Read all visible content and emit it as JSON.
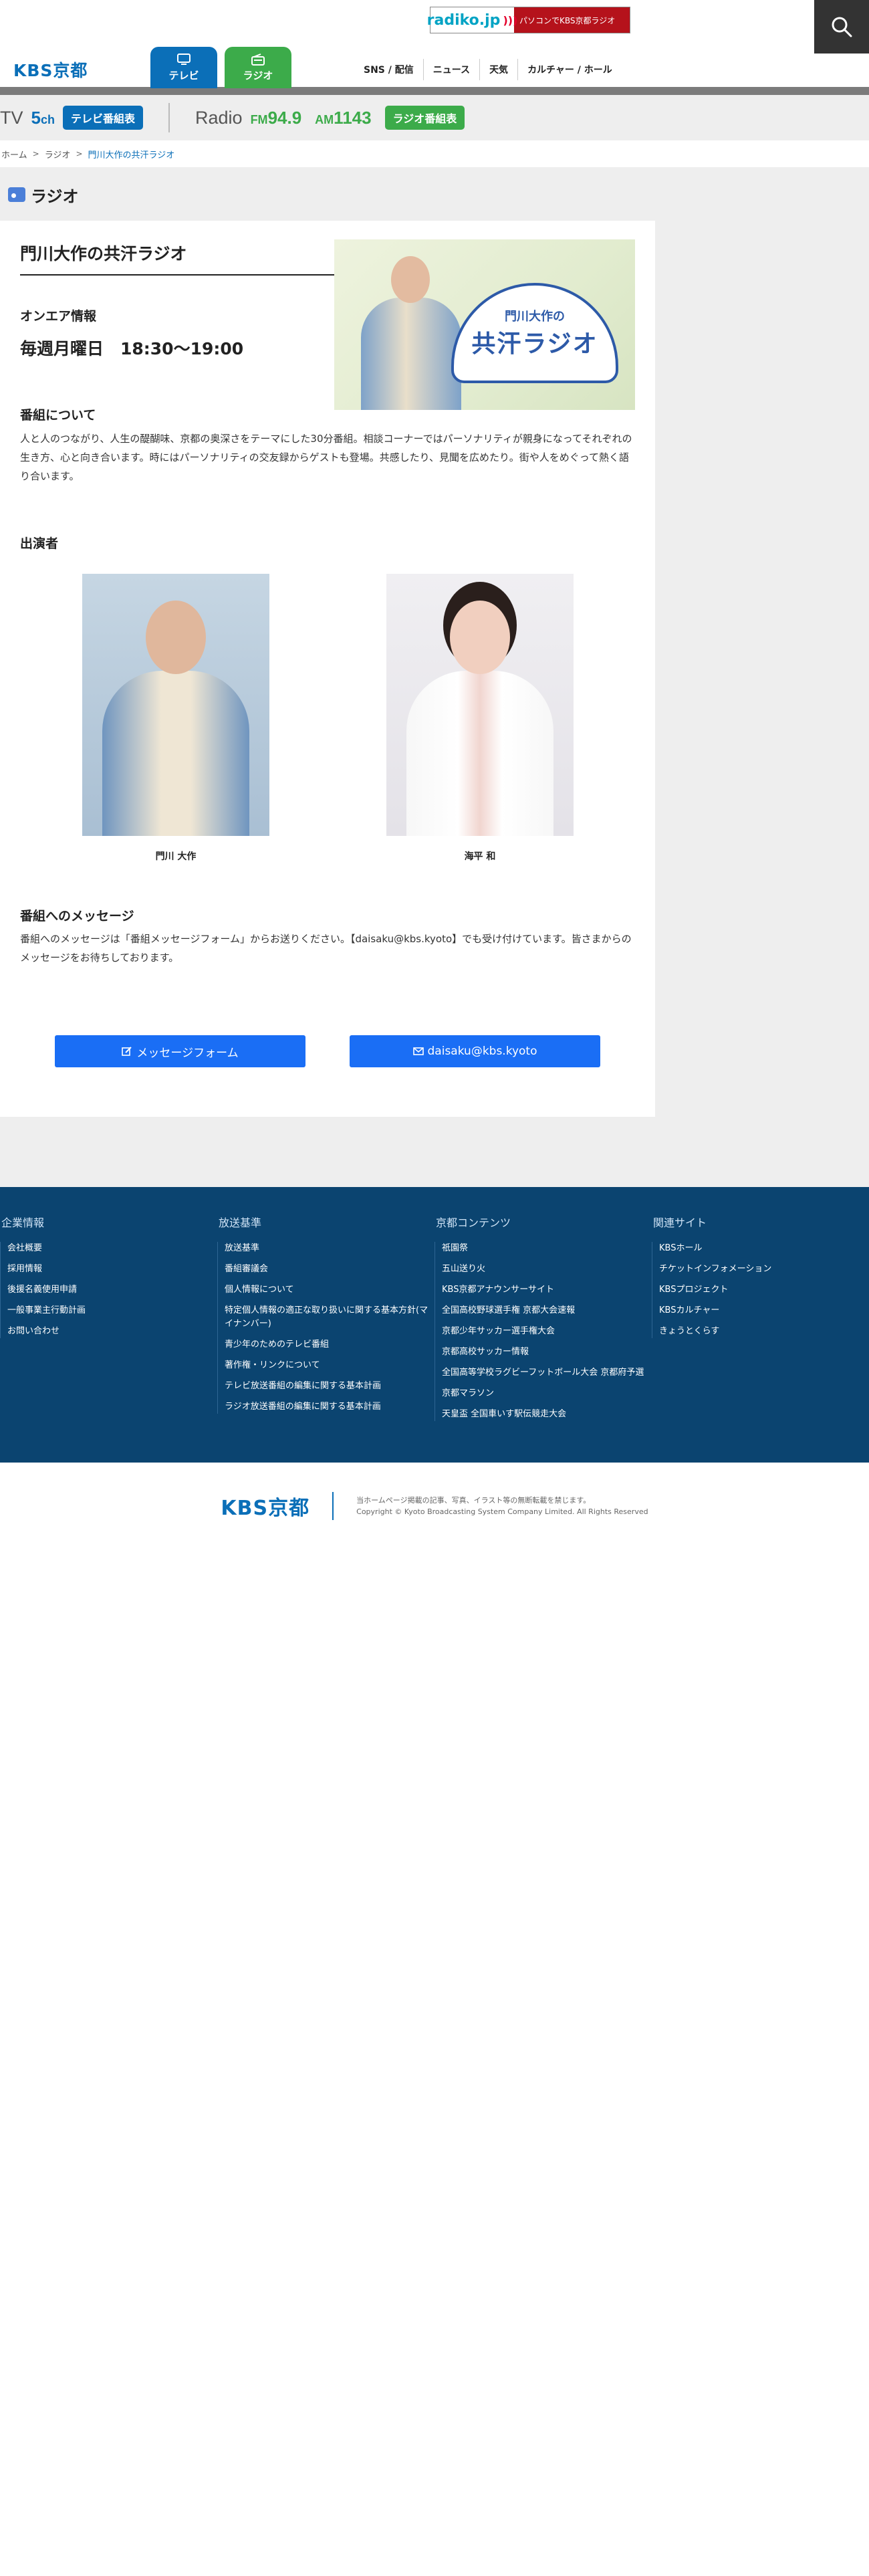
{
  "header": {
    "site_logo": "KBS京都",
    "radiko_logo": "radiko.jp",
    "radiko_text": "パソコンでKBS京都ラジオ",
    "tabs": [
      {
        "label": "テレビ"
      },
      {
        "label": "ラジオ"
      }
    ],
    "nav": [
      "SNS / 配信",
      "ニュース",
      "天気",
      "カルチャー / ホール"
    ]
  },
  "channel_bar": {
    "tv_label": "TV",
    "tv_channel": "5",
    "tv_channel_unit": "ch",
    "tv_schedule": "テレビ番組表",
    "radio_label": "Radio",
    "fm_label": "FM",
    "fm_value": "94.9",
    "am_label": "AM",
    "am_value": "1143",
    "radio_schedule": "ラジオ番組表"
  },
  "breadcrumb": [
    "ホーム",
    "ラジオ",
    "門川大作の共汗ラジオ"
  ],
  "section_title": "ラジオ",
  "program": {
    "title": "門川大作の共汗ラジオ",
    "image_sub": "門川大作の",
    "image_main": "共汗ラジオ",
    "onair_heading": "オンエア情報",
    "onair_time": "毎週月曜日　18:30〜19:00",
    "about_heading": "番組について",
    "about_text": "人と人のつながり、人生の醍醐味、京都の奥深さをテーマにした30分番組。相談コーナーではパーソナリティが親身になってそれぞれの生き方、心と向き合います。時にはパーソナリティの交友録からゲストも登場。共感したり、見聞を広めたり。街や人をめぐって熱く語り合います。",
    "performers_heading": "出演者",
    "performers": [
      {
        "name": "門川 大作"
      },
      {
        "name": "海平 和"
      }
    ],
    "message_heading": "番組へのメッセージ",
    "message_text": "番組へのメッセージは「番組メッセージフォーム」からお送りください。【daisaku@kbs.kyoto】でも受け付けています。皆さまからのメッセージをお待ちしております。",
    "form_button": "メッセージフォーム",
    "email_button": "daisaku@kbs.kyoto"
  },
  "footer": {
    "columns": [
      {
        "title": "企業情報",
        "items": [
          "会社概要",
          "採用情報",
          "後援名義使用申請",
          "一般事業主行動計画",
          "お問い合わせ"
        ]
      },
      {
        "title": "放送基準",
        "items": [
          "放送基準",
          "番組審議会",
          "個人情報について",
          "特定個人情報の適正な取り扱いに関する基本方針(マイナンバー)",
          "青少年のためのテレビ番組",
          "著作権・リンクについて",
          "テレビ放送番組の編集に関する基本計画",
          "ラジオ放送番組の編集に関する基本計画"
        ]
      },
      {
        "title": "京都コンテンツ",
        "items": [
          "祇園祭",
          "五山送り火",
          "KBS京都アナウンサーサイト",
          "全国高校野球選手権 京都大会速報",
          "京都少年サッカー選手権大会",
          "京都高校サッカー情報",
          "全国高等学校ラグビーフットボール大会 京都府予選",
          "京都マラソン",
          "天皇盃 全国車いす駅伝競走大会"
        ]
      },
      {
        "title": "関連サイト",
        "items": [
          "KBSホール",
          "チケットインフォメーション",
          "KBSプロジェクト",
          "KBSカルチャー",
          "きょうとくらす"
        ]
      }
    ],
    "logo": "KBS京都",
    "notice": "当ホームページ掲載の記事、写真、イラスト等の無断転載を禁じます。",
    "copyright": "Copyright © Kyoto Broadcasting System Company Limited. All Rights Reserved"
  }
}
